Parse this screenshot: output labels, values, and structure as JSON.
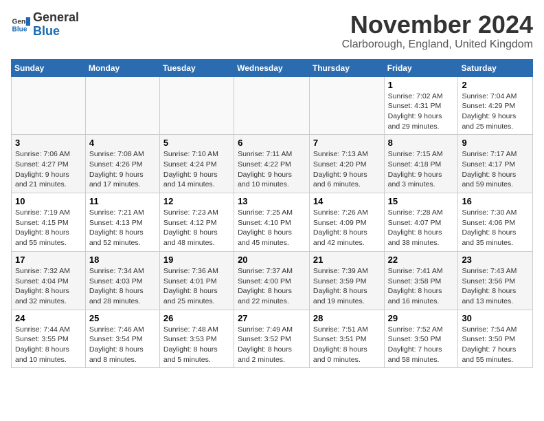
{
  "header": {
    "logo_line1": "General",
    "logo_line2": "Blue",
    "month_title": "November 2024",
    "location": "Clarborough, England, United Kingdom"
  },
  "days_of_week": [
    "Sunday",
    "Monday",
    "Tuesday",
    "Wednesday",
    "Thursday",
    "Friday",
    "Saturday"
  ],
  "weeks": [
    [
      {
        "day": "",
        "info": ""
      },
      {
        "day": "",
        "info": ""
      },
      {
        "day": "",
        "info": ""
      },
      {
        "day": "",
        "info": ""
      },
      {
        "day": "",
        "info": ""
      },
      {
        "day": "1",
        "info": "Sunrise: 7:02 AM\nSunset: 4:31 PM\nDaylight: 9 hours and 29 minutes."
      },
      {
        "day": "2",
        "info": "Sunrise: 7:04 AM\nSunset: 4:29 PM\nDaylight: 9 hours and 25 minutes."
      }
    ],
    [
      {
        "day": "3",
        "info": "Sunrise: 7:06 AM\nSunset: 4:27 PM\nDaylight: 9 hours and 21 minutes."
      },
      {
        "day": "4",
        "info": "Sunrise: 7:08 AM\nSunset: 4:26 PM\nDaylight: 9 hours and 17 minutes."
      },
      {
        "day": "5",
        "info": "Sunrise: 7:10 AM\nSunset: 4:24 PM\nDaylight: 9 hours and 14 minutes."
      },
      {
        "day": "6",
        "info": "Sunrise: 7:11 AM\nSunset: 4:22 PM\nDaylight: 9 hours and 10 minutes."
      },
      {
        "day": "7",
        "info": "Sunrise: 7:13 AM\nSunset: 4:20 PM\nDaylight: 9 hours and 6 minutes."
      },
      {
        "day": "8",
        "info": "Sunrise: 7:15 AM\nSunset: 4:18 PM\nDaylight: 9 hours and 3 minutes."
      },
      {
        "day": "9",
        "info": "Sunrise: 7:17 AM\nSunset: 4:17 PM\nDaylight: 8 hours and 59 minutes."
      }
    ],
    [
      {
        "day": "10",
        "info": "Sunrise: 7:19 AM\nSunset: 4:15 PM\nDaylight: 8 hours and 55 minutes."
      },
      {
        "day": "11",
        "info": "Sunrise: 7:21 AM\nSunset: 4:13 PM\nDaylight: 8 hours and 52 minutes."
      },
      {
        "day": "12",
        "info": "Sunrise: 7:23 AM\nSunset: 4:12 PM\nDaylight: 8 hours and 48 minutes."
      },
      {
        "day": "13",
        "info": "Sunrise: 7:25 AM\nSunset: 4:10 PM\nDaylight: 8 hours and 45 minutes."
      },
      {
        "day": "14",
        "info": "Sunrise: 7:26 AM\nSunset: 4:09 PM\nDaylight: 8 hours and 42 minutes."
      },
      {
        "day": "15",
        "info": "Sunrise: 7:28 AM\nSunset: 4:07 PM\nDaylight: 8 hours and 38 minutes."
      },
      {
        "day": "16",
        "info": "Sunrise: 7:30 AM\nSunset: 4:06 PM\nDaylight: 8 hours and 35 minutes."
      }
    ],
    [
      {
        "day": "17",
        "info": "Sunrise: 7:32 AM\nSunset: 4:04 PM\nDaylight: 8 hours and 32 minutes."
      },
      {
        "day": "18",
        "info": "Sunrise: 7:34 AM\nSunset: 4:03 PM\nDaylight: 8 hours and 28 minutes."
      },
      {
        "day": "19",
        "info": "Sunrise: 7:36 AM\nSunset: 4:01 PM\nDaylight: 8 hours and 25 minutes."
      },
      {
        "day": "20",
        "info": "Sunrise: 7:37 AM\nSunset: 4:00 PM\nDaylight: 8 hours and 22 minutes."
      },
      {
        "day": "21",
        "info": "Sunrise: 7:39 AM\nSunset: 3:59 PM\nDaylight: 8 hours and 19 minutes."
      },
      {
        "day": "22",
        "info": "Sunrise: 7:41 AM\nSunset: 3:58 PM\nDaylight: 8 hours and 16 minutes."
      },
      {
        "day": "23",
        "info": "Sunrise: 7:43 AM\nSunset: 3:56 PM\nDaylight: 8 hours and 13 minutes."
      }
    ],
    [
      {
        "day": "24",
        "info": "Sunrise: 7:44 AM\nSunset: 3:55 PM\nDaylight: 8 hours and 10 minutes."
      },
      {
        "day": "25",
        "info": "Sunrise: 7:46 AM\nSunset: 3:54 PM\nDaylight: 8 hours and 8 minutes."
      },
      {
        "day": "26",
        "info": "Sunrise: 7:48 AM\nSunset: 3:53 PM\nDaylight: 8 hours and 5 minutes."
      },
      {
        "day": "27",
        "info": "Sunrise: 7:49 AM\nSunset: 3:52 PM\nDaylight: 8 hours and 2 minutes."
      },
      {
        "day": "28",
        "info": "Sunrise: 7:51 AM\nSunset: 3:51 PM\nDaylight: 8 hours and 0 minutes."
      },
      {
        "day": "29",
        "info": "Sunrise: 7:52 AM\nSunset: 3:50 PM\nDaylight: 7 hours and 58 minutes."
      },
      {
        "day": "30",
        "info": "Sunrise: 7:54 AM\nSunset: 3:50 PM\nDaylight: 7 hours and 55 minutes."
      }
    ]
  ]
}
